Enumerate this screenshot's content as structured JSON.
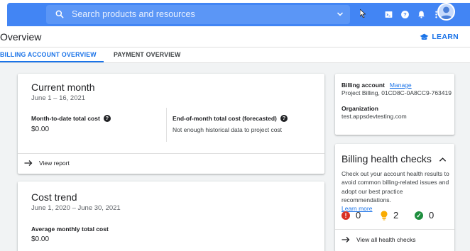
{
  "header": {
    "search_placeholder": "Search products and resources"
  },
  "page": {
    "title": "Overview",
    "learn_label": "LEARN"
  },
  "tabs": [
    {
      "label": "BILLING ACCOUNT OVERVIEW",
      "active": true
    },
    {
      "label": "PAYMENT OVERVIEW",
      "active": false
    }
  ],
  "current_month": {
    "title": "Current month",
    "date_range": "June 1 – 16, 2021",
    "mtd_label": "Month-to-date total cost",
    "mtd_value": "$0.00",
    "eom_label": "End-of-month total cost (forecasted)",
    "eom_value": "Not enough historical data to project cost",
    "view_report": "View report"
  },
  "cost_trend": {
    "title": "Cost trend",
    "date_range": "June 1, 2020 – June 30, 2021",
    "avg_label": "Average monthly total cost",
    "avg_value": "$0.00"
  },
  "billing_account": {
    "label": "Billing account",
    "manage_label": "Manage",
    "account_value": "Project Billing, 01CD8C-0A8CC9-763419",
    "org_label": "Organization",
    "org_value": "test.appsdevtesting.com"
  },
  "health_checks": {
    "title": "Billing health checks",
    "description": "Check out your account health results to avoid common billing-related issues and adopt our best practice recommendations.",
    "learn_more": "Learn more",
    "errors": "0",
    "warnings": "2",
    "passed": "0",
    "view_all": "View all health checks"
  },
  "colors": {
    "primary": "#1a73e8",
    "topbar": "#4285f4",
    "error": "#d93025",
    "warning": "#f9ab00",
    "success": "#1e8e3e"
  }
}
